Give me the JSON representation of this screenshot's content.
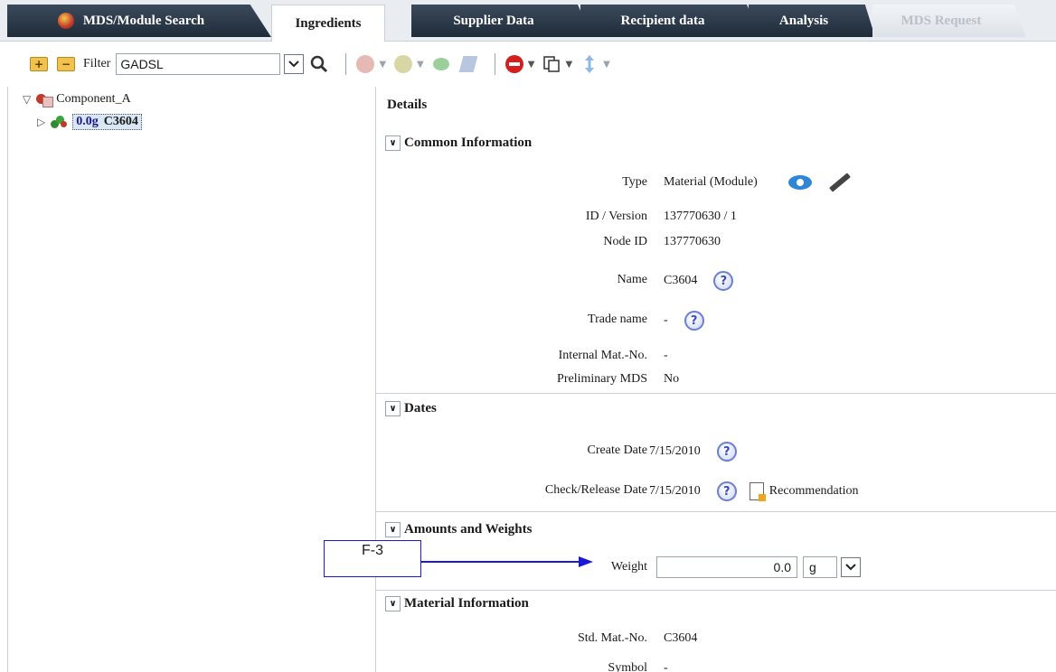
{
  "tabs": [
    {
      "label": "MDS/Module Search",
      "state": "dark"
    },
    {
      "label": "Ingredients",
      "state": "active"
    },
    {
      "label": "Supplier Data",
      "state": "dark"
    },
    {
      "label": "Recipient data",
      "state": "dark"
    },
    {
      "label": "Analysis",
      "state": "dark"
    },
    {
      "label": "MDS Request",
      "state": "disabled"
    }
  ],
  "toolbar": {
    "filter_label": "Filter",
    "filter_value": "GADSL"
  },
  "tree": {
    "root_label": "Component_A",
    "child_weight": "0.0g",
    "child_label": "C3604"
  },
  "details": {
    "title": "Details",
    "common": {
      "heading": "Common Information",
      "type_label": "Type",
      "type_value": "Material (Module)",
      "id_label": "ID / Version",
      "id_value": "137770630 / 1",
      "node_label": "Node ID",
      "node_value": "137770630",
      "name_label": "Name",
      "name_value": "C3604",
      "trade_label": "Trade name",
      "trade_value": "-",
      "internal_label": "Internal Mat.-No.",
      "internal_value": "-",
      "prelim_label": "Preliminary MDS",
      "prelim_value": "No"
    },
    "dates": {
      "heading": "Dates",
      "create_label": "Create Date",
      "create_value": "7/15/2010",
      "check_label": "Check/Release Date",
      "check_value": "7/15/2010",
      "recommendation": "Recommendation"
    },
    "amounts": {
      "heading": "Amounts and Weights",
      "weight_label": "Weight",
      "weight_value": "0.0",
      "unit_value": "g"
    },
    "material": {
      "heading": "Material Information",
      "std_label": "Std. Mat.-No.",
      "std_value": "C3604",
      "symbol_label": "Symbol",
      "symbol_value": "-"
    }
  },
  "annotation": {
    "callout_text": "F-3"
  },
  "colors": {
    "tab_dark": "#1f2b39",
    "callout_blue": "#1a1ad6",
    "help_icon": "#6b7fd6"
  }
}
